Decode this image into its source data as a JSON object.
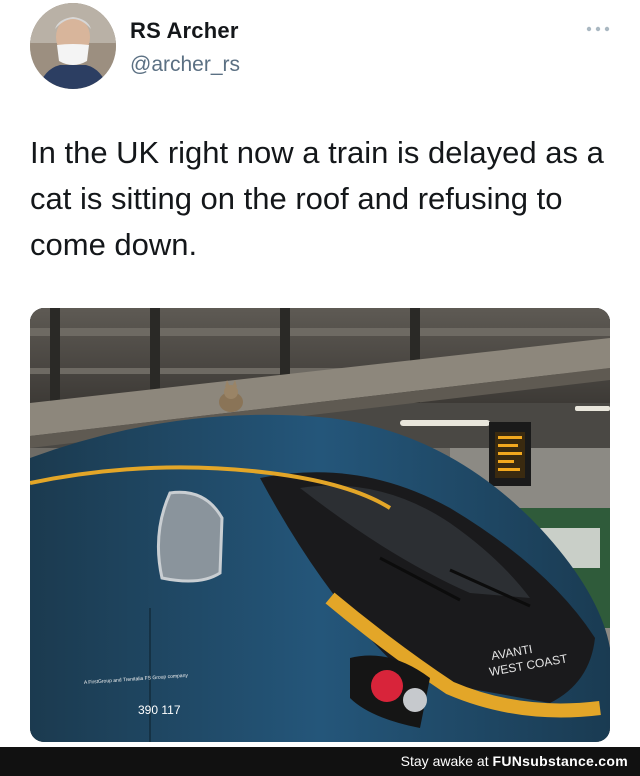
{
  "tweet": {
    "author_name": "RS Archer",
    "author_handle": "@archer_rs",
    "more_icon": "ellipsis-icon",
    "text": "In the UK right now a train is delayed as a cat is sitting on the roof and refusing to come down."
  },
  "photo": {
    "train_brand_line1": "AVANTI",
    "train_brand_line2": "WEST COAST",
    "unit_number": "390 117",
    "company_line": "A FirstGroup and Trenitalia FS Group company"
  },
  "footer": {
    "prefix": "Stay awake at ",
    "brand": "FUNsubstance.com"
  },
  "colors": {
    "train_body": "#1e4a63",
    "train_stripe": "#e3a628",
    "footer_bg": "#111111",
    "handle": "#5b7083"
  }
}
